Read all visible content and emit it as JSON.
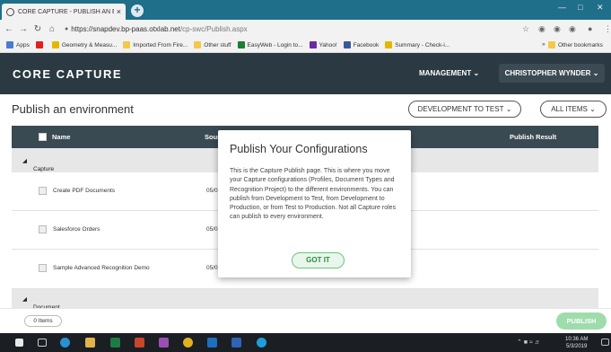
{
  "browser": {
    "tab_title": "CORE CAPTURE - PUBLISH AN E...",
    "tab_close": "×",
    "new_tab": "+",
    "url_host": "https://snapdev.bp-paas.otxlab.net",
    "url_path": "/cp-swc/Publish.aspx",
    "bookmarks": [
      {
        "label": "Apps",
        "color": "#4a7bd0"
      },
      {
        "label": "",
        "color": "#e02020"
      },
      {
        "label": "Geometry & Measu...",
        "color": "#e5b800"
      },
      {
        "label": "Imported From Fire...",
        "color": "#f2c94c"
      },
      {
        "label": "Other stuff",
        "color": "#f2c94c"
      },
      {
        "label": "EasyWeb - Login to...",
        "color": "#1a7f37"
      },
      {
        "label": "Yahoo!",
        "color": "#6b2aa5"
      },
      {
        "label": "Facebook",
        "color": "#3b5998"
      },
      {
        "label": "Summary - Check-i...",
        "color": "#e5b800"
      }
    ],
    "other_bookmarks": "Other bookmarks",
    "bm_more": "»"
  },
  "header": {
    "brand": "CORE CAPTURE",
    "management": "MANAGEMENT",
    "user": "CHRISTOPHER WYNDER"
  },
  "page": {
    "title": "Publish an environment",
    "env_dropdown": "DEVELOPMENT TO TEST",
    "items_dropdown": "ALL ITEMS"
  },
  "table": {
    "col_name": "Name",
    "col_source": "Sour",
    "col_result": "Publish Result",
    "groups": [
      {
        "label": "Capture Profiles (3 )"
      },
      {
        "label": "Document Types (6 )"
      }
    ],
    "rows": [
      {
        "name": "Create PDF Documents",
        "date": "05/0"
      },
      {
        "name": "Salesforce Orders",
        "date": "05/0"
      },
      {
        "name": "Sample Advanced Recognition Demo",
        "date": "05/0"
      }
    ]
  },
  "footer": {
    "items_count": "0 Items",
    "publish": "PUBLISH"
  },
  "modal": {
    "title": "Publish Your Configurations",
    "body": "This is the Capture Publish page. This is where you move your Capture configurations (Profiles, Document Types and Recognition Project) to the different environments. You can publish from Development to Test, from Development to Production, or from Test to Production. Not all Capture roles can publish to every environment.",
    "button": "GOT IT"
  },
  "taskbar": {
    "time": "10:36 AM",
    "date": "5/3/2019"
  },
  "colors": {
    "header_bg": "#2b3a42",
    "table_head_bg": "#3a4a52",
    "accent_green": "#6cc380",
    "publish_bg": "#9fdcab",
    "browser_tab_bg": "#1f6f8b"
  }
}
